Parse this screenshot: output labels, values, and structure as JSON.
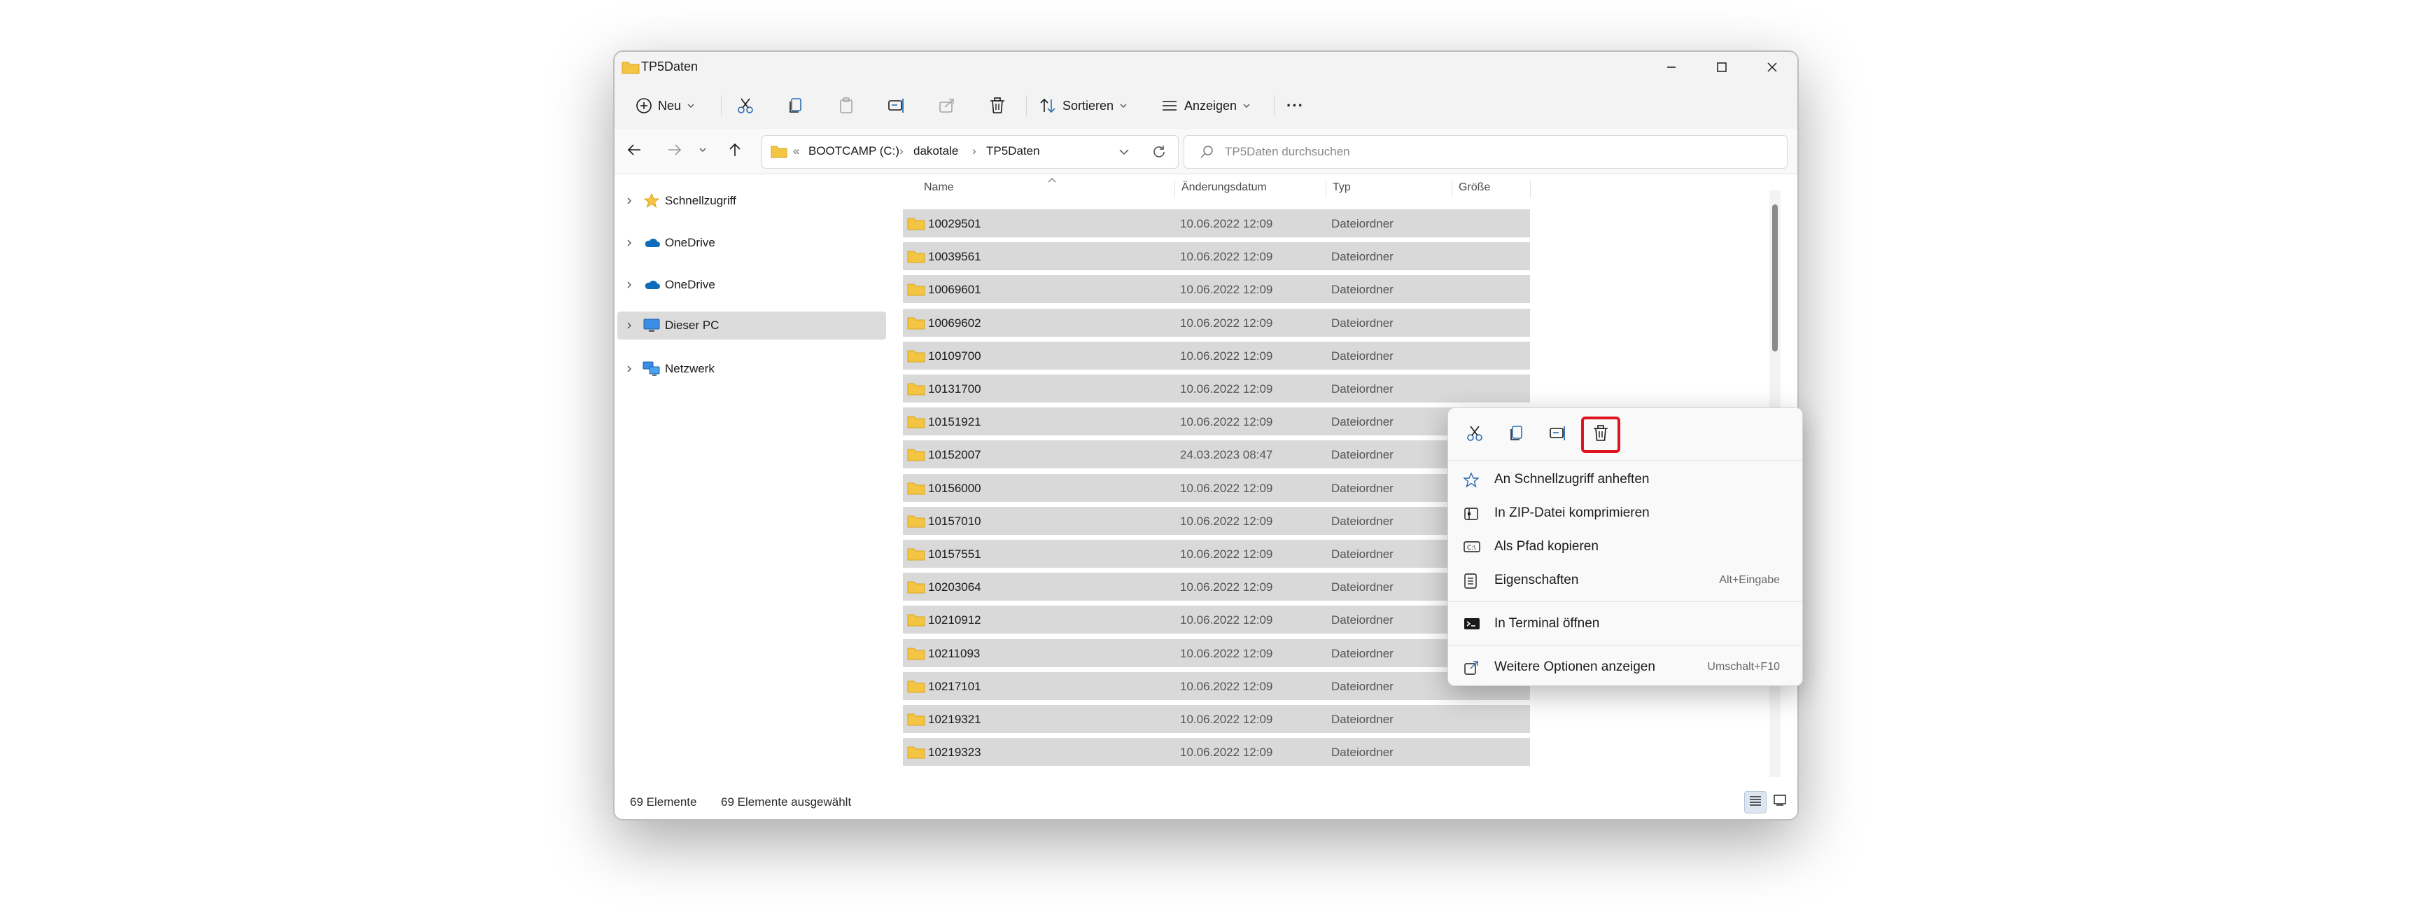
{
  "window": {
    "title": "TP5Daten",
    "controls": [
      "minimize",
      "maximize",
      "close"
    ]
  },
  "toolbar": {
    "new_label": "Neu",
    "sort_label": "Sortieren",
    "view_label": "Anzeigen",
    "more_label": "···"
  },
  "address": {
    "crumbs": [
      "BOOTCAMP (C:)",
      "dakotale",
      "TP5Daten"
    ],
    "overflow": "«"
  },
  "search": {
    "placeholder": "TP5Daten durchsuchen"
  },
  "nav": {
    "items": [
      {
        "label": "Schnellzugriff",
        "icon": "star-icon"
      },
      {
        "label": "OneDrive",
        "icon": "cloud-icon"
      },
      {
        "label": "OneDrive",
        "icon": "cloud-icon"
      },
      {
        "label": "Dieser PC",
        "icon": "monitor-icon",
        "selected": true
      },
      {
        "label": "Netzwerk",
        "icon": "network-icon"
      }
    ]
  },
  "columns": {
    "name": "Name",
    "date": "Änderungsdatum",
    "type": "Typ",
    "size": "Größe"
  },
  "files": [
    {
      "name": "10029501",
      "date": "10.06.2022 12:09",
      "type": "Dateiordner"
    },
    {
      "name": "10039561",
      "date": "10.06.2022 12:09",
      "type": "Dateiordner"
    },
    {
      "name": "10069601",
      "date": "10.06.2022 12:09",
      "type": "Dateiordner"
    },
    {
      "name": "10069602",
      "date": "10.06.2022 12:09",
      "type": "Dateiordner"
    },
    {
      "name": "10109700",
      "date": "10.06.2022 12:09",
      "type": "Dateiordner"
    },
    {
      "name": "10131700",
      "date": "10.06.2022 12:09",
      "type": "Dateiordner"
    },
    {
      "name": "10151921",
      "date": "10.06.2022 12:09",
      "type": "Dateiordner"
    },
    {
      "name": "10152007",
      "date": "24.03.2023 08:47",
      "type": "Dateiordner"
    },
    {
      "name": "10156000",
      "date": "10.06.2022 12:09",
      "type": "Dateiordner"
    },
    {
      "name": "10157010",
      "date": "10.06.2022 12:09",
      "type": "Dateiordner"
    },
    {
      "name": "10157551",
      "date": "10.06.2022 12:09",
      "type": "Dateiordner"
    },
    {
      "name": "10203064",
      "date": "10.06.2022 12:09",
      "type": "Dateiordner"
    },
    {
      "name": "10210912",
      "date": "10.06.2022 12:09",
      "type": "Dateiordner"
    },
    {
      "name": "10211093",
      "date": "10.06.2022 12:09",
      "type": "Dateiordner"
    },
    {
      "name": "10217101",
      "date": "10.06.2022 12:09",
      "type": "Dateiordner"
    },
    {
      "name": "10219321",
      "date": "10.06.2022 12:09",
      "type": "Dateiordner"
    },
    {
      "name": "10219323",
      "date": "10.06.2022 12:09",
      "type": "Dateiordner"
    }
  ],
  "status": {
    "count": "69 Elemente",
    "selected": "69 Elemente ausgewählt"
  },
  "context_menu": {
    "tools": [
      {
        "icon": "scissors-icon"
      },
      {
        "icon": "copy-icon"
      },
      {
        "icon": "rename-icon"
      },
      {
        "icon": "trash-icon",
        "highlighted": true
      }
    ],
    "items": [
      {
        "label": "An Schnellzugriff anheften",
        "icon": "star-outline-icon",
        "shortcut": ""
      },
      {
        "label": "In ZIP-Datei komprimieren",
        "icon": "zip-icon",
        "shortcut": ""
      },
      {
        "label": "Als Pfad kopieren",
        "icon": "path-icon",
        "shortcut": ""
      },
      {
        "label": "Eigenschaften",
        "icon": "properties-icon",
        "shortcut": "Alt+Eingabe"
      },
      {
        "label": "In Terminal öffnen",
        "icon": "terminal-icon",
        "shortcut": ""
      },
      {
        "label": "Weitere Optionen anzeigen",
        "icon": "external-icon",
        "shortcut": "Umschalt+F10"
      }
    ]
  },
  "colors": {
    "selection_row": "#d9d9d9",
    "highlight_border": "#e0141e",
    "folder": "#f4c542",
    "accent": "#0067c0"
  }
}
